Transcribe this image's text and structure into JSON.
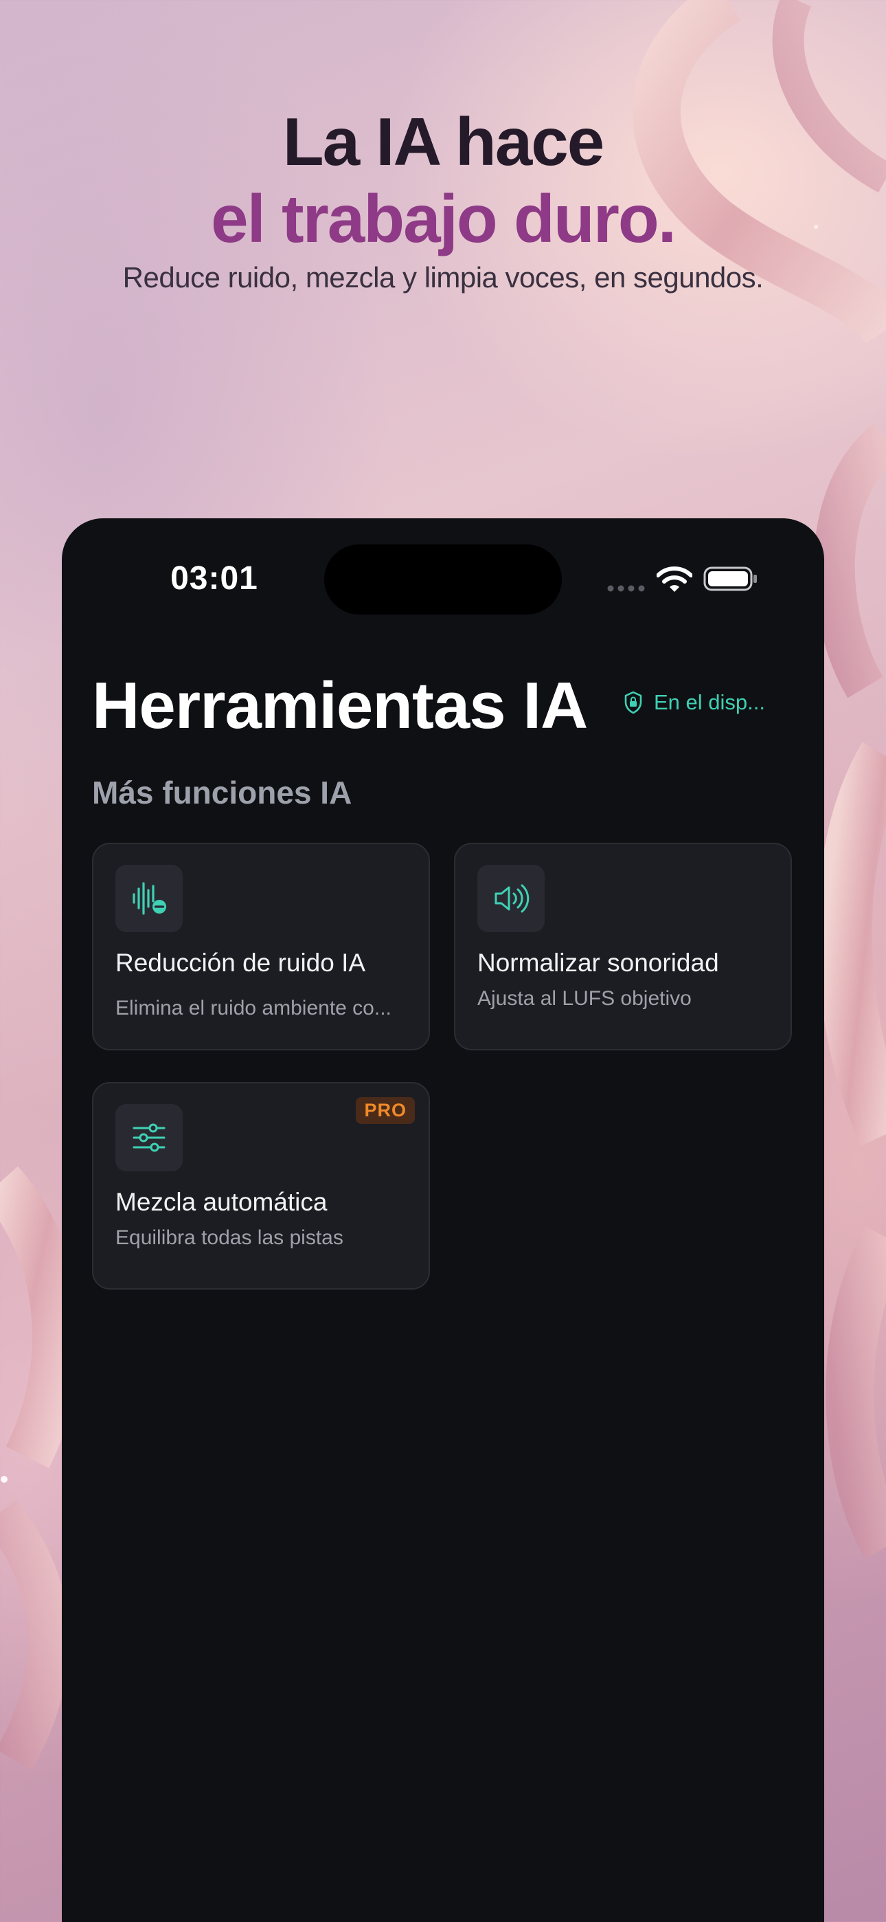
{
  "promo": {
    "headline_line1": "La IA hace",
    "headline_line2": "el trabajo duro.",
    "subtitle": "Reduce ruido, mezcla y limpia voces, en segundos."
  },
  "status_bar": {
    "time": "03:01"
  },
  "screen": {
    "title": "Herramientas IA",
    "device_badge": "En el disp...",
    "section_title": "Más funciones IA"
  },
  "features": [
    {
      "title": "Reducción de ruido IA",
      "subtitle": "Elimina el ruido ambiente co...",
      "icon": "waveform-minus-icon"
    },
    {
      "title": "Normalizar sonoridad",
      "subtitle": "Ajusta al LUFS objetivo",
      "icon": "speaker-wave-icon"
    },
    {
      "title": "Mezcla automática",
      "subtitle": "Equilibra todas las pistas",
      "icon": "sliders-icon",
      "badge": "PRO"
    }
  ],
  "colors": {
    "accent": "#3fd1b5",
    "headline_highlight": "#8e3a86",
    "pro_badge": "#f08a2a",
    "screen_bg": "#0f1013"
  }
}
